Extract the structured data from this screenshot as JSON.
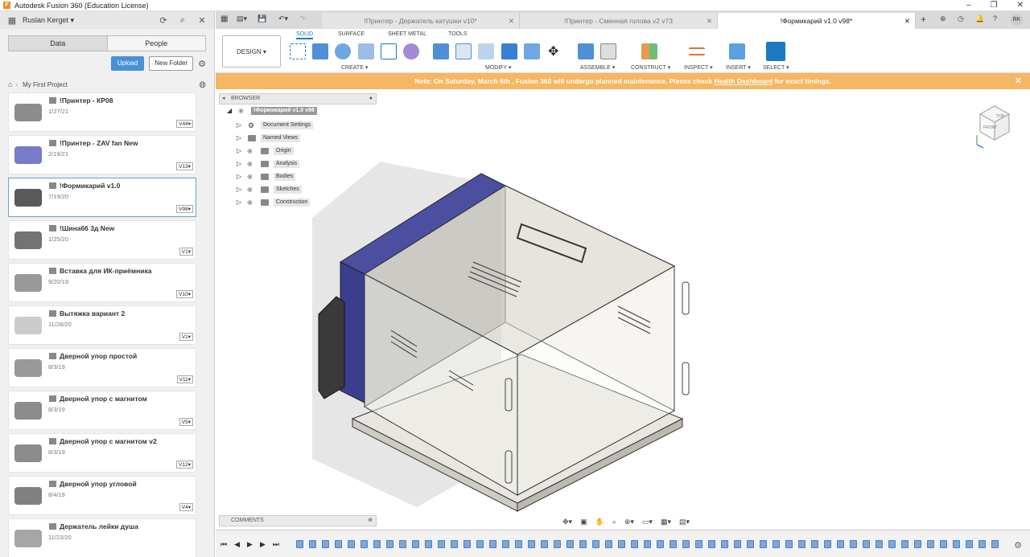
{
  "window": {
    "title": "Autodesk Fusion 360 (Education License)",
    "controls": [
      "–",
      "❐",
      "✕"
    ]
  },
  "left_panel": {
    "user": "Ruslan Kerget",
    "tabs": [
      "Data",
      "People"
    ],
    "upload_label": "Upload",
    "new_folder_label": "New Folder",
    "project": "My First Project",
    "files": [
      {
        "name": "!Принтер - КР08",
        "date": "1/27/21",
        "version": "V44"
      },
      {
        "name": "!Принтер - ZAV fan New",
        "date": "2/19/21",
        "version": "V13"
      },
      {
        "name": "!Формикарий v1.0",
        "date": "7/19/20",
        "version": "V98"
      },
      {
        "name": "!Шина66 3д New",
        "date": "1/25/20",
        "version": "V1"
      },
      {
        "name": "Вставка для ИК-приёмника",
        "date": "9/20/19",
        "version": "V10"
      },
      {
        "name": "Вытяжка вариант 2",
        "date": "11/28/20",
        "version": "V1"
      },
      {
        "name": "Дверной упор простой",
        "date": "8/3/19",
        "version": "V11"
      },
      {
        "name": "Дверной упор с магнитом",
        "date": "8/3/19",
        "version": "V5"
      },
      {
        "name": "Дверной упор с магнитом v2",
        "date": "8/3/19",
        "version": "V12"
      },
      {
        "name": "Дверной упор угловой",
        "date": "8/4/19",
        "version": "V4"
      },
      {
        "name": "Держатель лейки душа",
        "date": "11/23/20",
        "version": ""
      }
    ]
  },
  "doc_tabs": [
    {
      "label": "!Принтер - Держатель катушки v10*"
    },
    {
      "label": "!Принтер - Сменная голова v2 v73"
    },
    {
      "label": "!Формикарий v1.0 v98*"
    }
  ],
  "toolbar": {
    "workspace": "DESIGN",
    "tabs": [
      "SOLID",
      "SURFACE",
      "SHEET METAL",
      "TOOLS"
    ],
    "groups": [
      "CREATE",
      "MODIFY",
      "ASSEMBLE",
      "CONSTRUCT",
      "INSPECT",
      "INSERT",
      "SELECT"
    ]
  },
  "notice": {
    "text_before": "Note: On Saturday, March 6th , Fusion 360 will undergo planned maintenance. Please check ",
    "link": "Health Dashboard",
    "text_after": " for exact timings."
  },
  "browser": {
    "header": "BROWSER",
    "root": "!Формикарий v1.0 v98",
    "nodes": [
      "Document Settings",
      "Named Views",
      "Origin",
      "Analysis",
      "Bodies",
      "Sketches",
      "Construction"
    ]
  },
  "comments_label": "COMMENTS",
  "viewcube": {
    "front": "FRONT",
    "top": "TOP"
  },
  "colors": {
    "accent": "#1b79c2",
    "notice_bg": "#f6b662",
    "panel_bg": "#f0f0f0"
  }
}
